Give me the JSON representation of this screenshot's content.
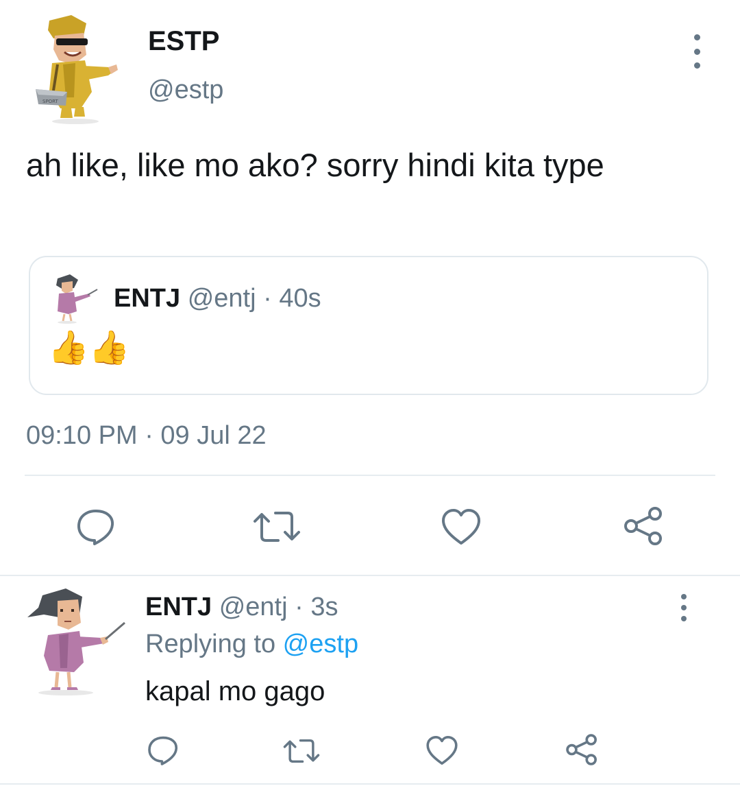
{
  "tweet": {
    "author_name": "ESTP",
    "author_handle": "@estp",
    "text": "ah like, like mo ako? sorry hindi kita type",
    "timestamp": "09:10 PM · 09 Jul 22",
    "quoted": {
      "author_name": "ENTJ",
      "meta": "@entj · 40s",
      "text": "👍👍"
    },
    "actions": [
      "reply-icon",
      "retweet-icon",
      "like-icon",
      "share-icon"
    ]
  },
  "reply": {
    "author_name": "ENTJ",
    "meta": "@entj · 3s",
    "replying_prefix": "Replying to ",
    "replying_to": "@estp",
    "text": "kapal mo gago"
  },
  "colors": {
    "text_primary": "#14171a",
    "text_secondary": "#657786",
    "link": "#1da1f2",
    "border": "#e1e8ed"
  }
}
